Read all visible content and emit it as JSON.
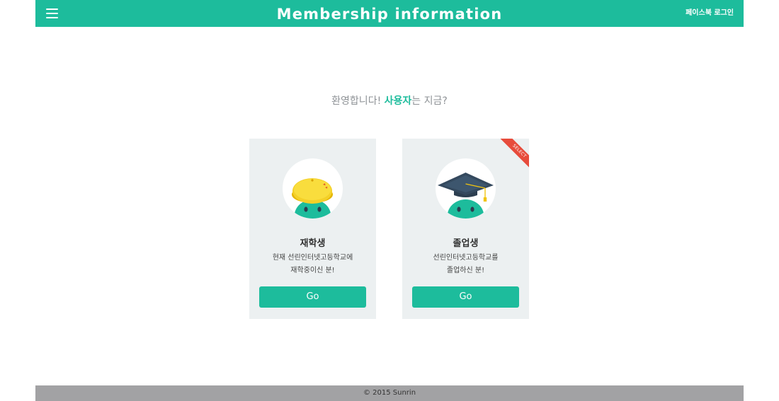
{
  "header": {
    "title": "Membership information",
    "menu_icon": "hamburger-menu-icon",
    "login_label": "페이스북 로그인"
  },
  "welcome": {
    "prefix": "환영합니다! ",
    "user": "사용자",
    "suffix": "는 지금?"
  },
  "cards": [
    {
      "title": "재학생",
      "desc_line1": "현재 선린인터넷고등학교에",
      "desc_line2": "재학중이신 분!",
      "button": "Go",
      "icon": "student-cap-avatar-icon"
    },
    {
      "title": "졸업생",
      "desc_line1": "선린인터넷고등학교를",
      "desc_line2": "졸업하신 분!",
      "button": "Go",
      "icon": "graduation-cap-avatar-icon",
      "ribbon": "SELECT"
    }
  ],
  "footer": {
    "copyright": "© 2015 Sunrin"
  },
  "colors": {
    "accent": "#1dbc9c",
    "card_bg": "#ecf0f1",
    "ribbon": "#e74c3c",
    "footer_bg": "#a2a2a4"
  }
}
